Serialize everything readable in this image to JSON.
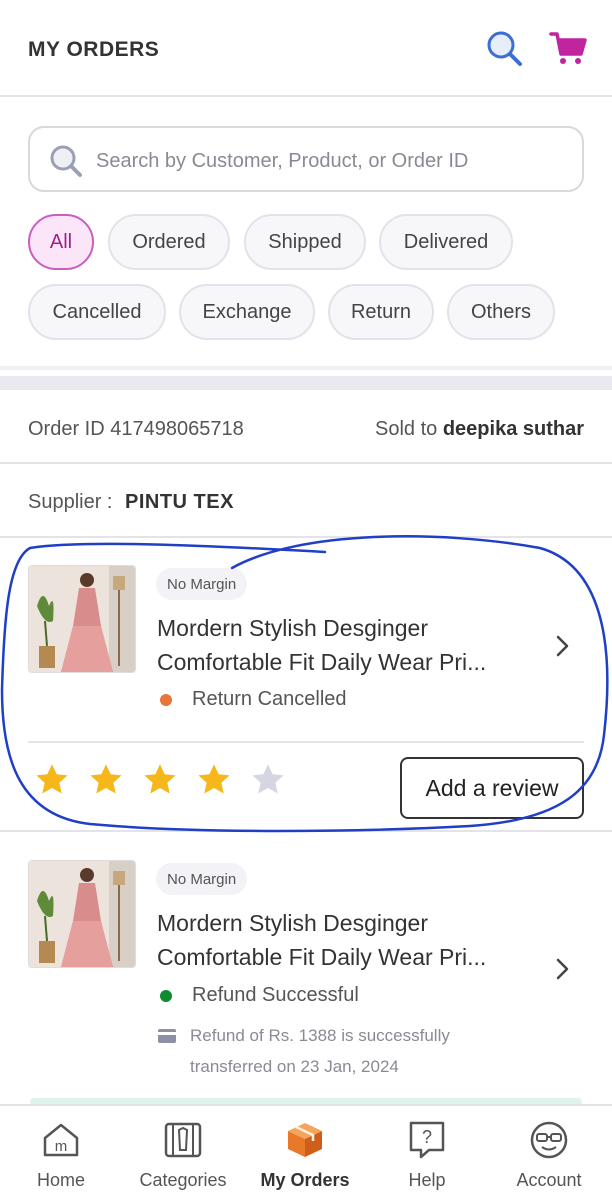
{
  "header": {
    "title": "MY ORDERS"
  },
  "search": {
    "placeholder": "Search by Customer, Product, or Order ID"
  },
  "filters": [
    "All",
    "Ordered",
    "Shipped",
    "Delivered",
    "Cancelled",
    "Exchange",
    "Return",
    "Others"
  ],
  "active_filter": "All",
  "order": {
    "order_id_text": "Order ID 417498065718",
    "sold_to_label": "Sold to",
    "sold_to_name": "deepika suthar",
    "supplier_label": "Supplier :",
    "supplier_name": "PINTU TEX"
  },
  "items": [
    {
      "badge": "No Margin",
      "name_line1": "Mordern Stylish Desginger",
      "name_line2": "Comfortable Fit Daily Wear Pri...",
      "status": "Return Cancelled",
      "status_color": "#e8753a",
      "rating": 4,
      "rating_max": 5,
      "review_button": "Add a review"
    },
    {
      "badge": "No Margin",
      "name_line1": "Mordern Stylish Desginger",
      "name_line2": "Comfortable Fit Daily Wear Pri...",
      "status": "Refund Successful",
      "status_color": "#0f8a2e",
      "note_line1": "Refund of Rs. 1388 is successfully",
      "note_line2": "transferred on 23 Jan, 2024"
    }
  ],
  "nav": [
    {
      "label": "Home",
      "icon": "home-icon"
    },
    {
      "label": "Categories",
      "icon": "categories-icon"
    },
    {
      "label": "My Orders",
      "icon": "box-icon",
      "active": true
    },
    {
      "label": "Help",
      "icon": "help-icon"
    },
    {
      "label": "Account",
      "icon": "account-icon"
    }
  ],
  "colors": {
    "accent": "#9f2089",
    "star_filled": "#f5b71a",
    "star_empty": "#d6d6e2",
    "annotation": "#1f3fc7"
  }
}
